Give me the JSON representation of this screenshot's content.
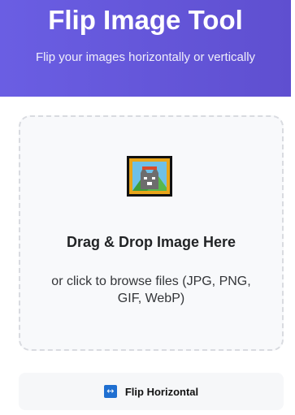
{
  "header": {
    "title": "Flip Image Tool",
    "subtitle": "Flip your images horizontally or vertically"
  },
  "dropzone": {
    "icon": "framed-picture-icon",
    "title": "Drag & Drop Image Here",
    "subtitle": "or click to browse files (JPG, PNG, GIF, WebP)"
  },
  "actions": {
    "flip_horizontal": {
      "icon": "left-right-arrow-icon",
      "label": "Flip Horizontal"
    }
  },
  "colors": {
    "header_gradient_start": "#6a5ee3",
    "header_gradient_end": "#5f4fd0",
    "dropzone_border": "#d9dbe0",
    "dropzone_background": "#f8f9fb",
    "button_background": "#f6f7f9",
    "icon_blue": "#1f6fd1"
  }
}
